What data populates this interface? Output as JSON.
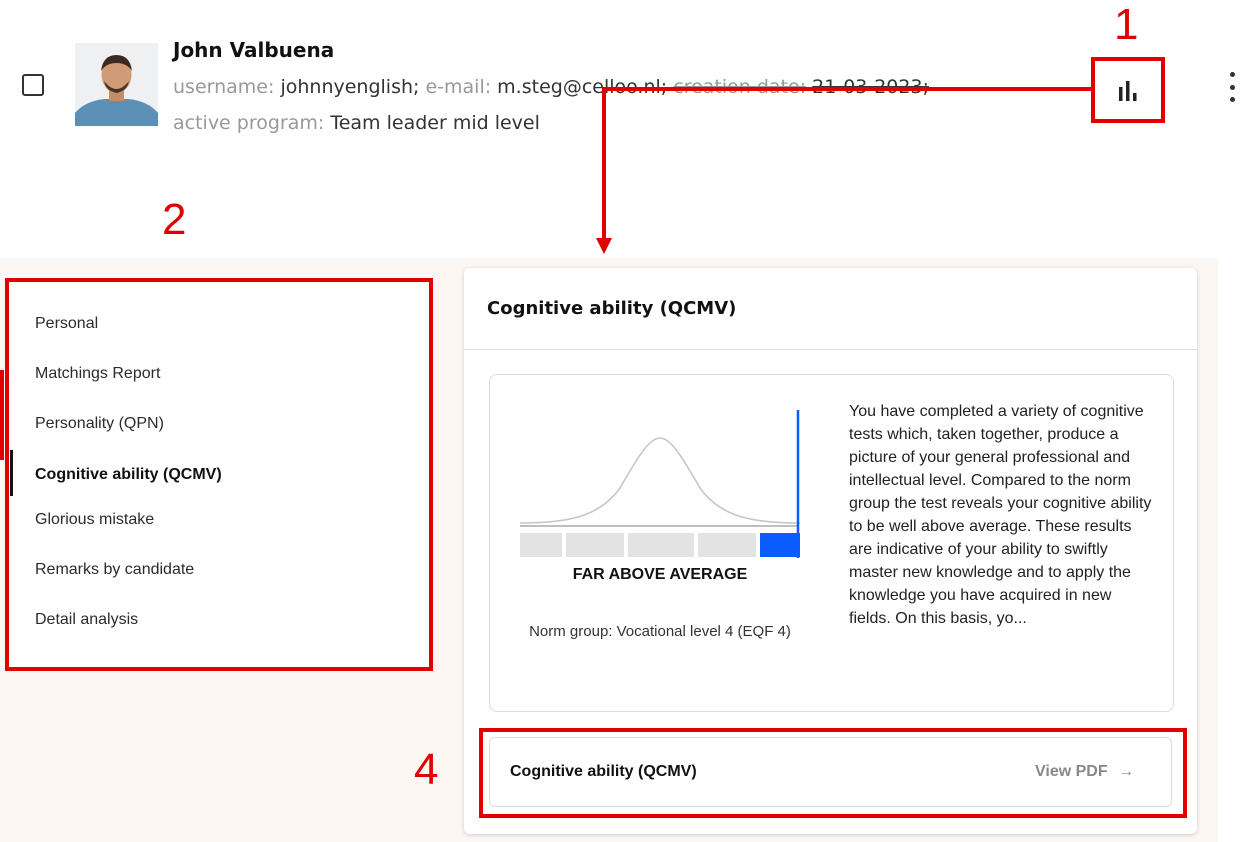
{
  "user": {
    "name": "John Valbuena",
    "username_label": "username:",
    "username": "johnnyenglish;",
    "email_label": "e-mail:",
    "email": "m.steg@celloo.nl;",
    "creation_label": "creation date:",
    "creation_date": "21-03-2023;",
    "program_label": "active program:",
    "program": "Team leader mid level"
  },
  "annotations": {
    "n1": "1",
    "n2": "2",
    "n4": "4"
  },
  "sidebar": {
    "items": [
      {
        "label": "Personal"
      },
      {
        "label": "Matchings Report"
      },
      {
        "label": "Personality (QPN)"
      },
      {
        "label": "Cognitive ability (QCMV)"
      },
      {
        "label": "Glorious mistake"
      },
      {
        "label": "Remarks by candidate"
      },
      {
        "label": "Detail analysis"
      }
    ],
    "active_index": 3
  },
  "report": {
    "title": "Cognitive ability (QCMV)",
    "result_label": "FAR ABOVE AVERAGE",
    "norm_group": "Norm group: Vocational level 4 (EQF 4)",
    "score_segment": 5,
    "segment_count": 5,
    "description": "You have completed a variety of cognitive tests which, taken together, produce a picture of your general professional and intellectual level. Compared to the norm group the test reveals your cognitive ability to be well above average. These results are indicative of your ability to swiftly master new knowledge and to apply the knowledge you have acquired in new fields. On this basis, yo...",
    "pdf": {
      "title": "Cognitive ability (QCMV)",
      "link_label": "View PDF",
      "arrow": "→"
    }
  },
  "colors": {
    "annotation_red": "#e00000",
    "score_blue": "#0a5cff",
    "segment_grey": "#e3e3e3",
    "panel_bg": "#fdf7f4"
  },
  "icons": {
    "stats": "bar-chart-icon",
    "menu": "more-vertical-icon",
    "arrow": "arrow-right-icon"
  }
}
